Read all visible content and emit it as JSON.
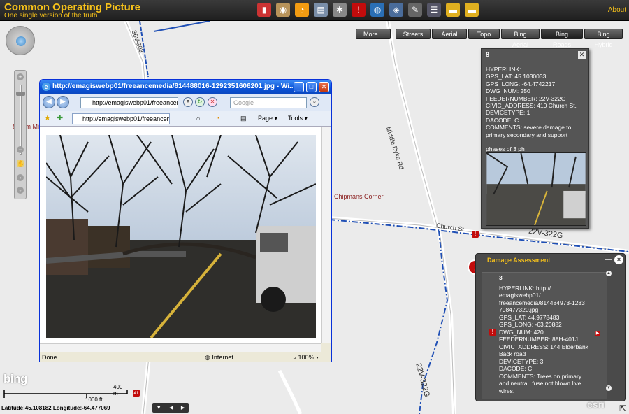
{
  "header": {
    "title": "Common Operating Picture",
    "subtitle": "One single version of the truth",
    "about_label": "About",
    "toolbar_icons": [
      "book-icon",
      "palette-icon",
      "rss-icon",
      "printer-icon",
      "settings-icon",
      "alert-icon",
      "globe-icon",
      "layers-icon",
      "tools-icon",
      "list-icon",
      "folder-icon",
      "folder-open-icon"
    ]
  },
  "basemaps": {
    "more_label": "More...",
    "options": [
      "Streets",
      "Aerial",
      "Topo",
      "Bing Aerial",
      "Bing Roads",
      "Bing Hybrid"
    ],
    "selected": "Bing Roads"
  },
  "map": {
    "labels": {
      "steam_mill": "Steam Mill",
      "chipmans_corner": "Chipmans Corner",
      "middle_dyke": "Middle Dyke Rd",
      "road_36v": "36V-303",
      "church_st": "Church St",
      "feeder_top": "22V-322G",
      "feeder_bottom": "22V-322G",
      "marker_41": "41"
    },
    "colors": {
      "feeder_line": "#1f4fb5",
      "alert_red": "#c20c0c",
      "accent_yellow": "#f7c21a"
    }
  },
  "popup8": {
    "id": "8",
    "lines": [
      "HYPERLINK:",
      "GPS_LAT: 45.1030033",
      "GPS_LONG: -64.4742217",
      "DWG_NUM: 250",
      "FEEDERNUMBER: 22V-322G",
      "CIVIC_ADDRESS: 410 Church St.",
      "DEVICETYPE: 1",
      "DACODE: C",
      "COMMENTS: severe damage to",
      "primary secondary and support",
      "",
      "phases of 3 ph"
    ]
  },
  "damage": {
    "title": "Damage Assessment",
    "minimize": "—",
    "close": "×",
    "id": "3",
    "lines": [
      "HYPERLINK: http://",
      "emagiswebp01/",
      "freeancemedia/814484973-1283",
      "708477320.jpg",
      "GPS_LAT: 44.9778483",
      "GPS_LONG: -63.20882",
      "DWG_NUM: 420",
      "FEEDERNUMBER: 88H-401J",
      "CIVIC_ADDRESS: 144 Elderbank",
      "Back road",
      "DEVICETYPE: 3",
      "DACODE: C",
      "COMMENTS: Trees on primary",
      "and neutral.  fuse not blown live",
      "wires."
    ]
  },
  "ie": {
    "title": "http://emagiswebp01/freeancemedia/814488016-1292351606201.jpg - Wi...",
    "address": "http://emagiswebp01/freeancer",
    "search_placeholder": "Google",
    "tab_label": "http://emagiswebp01/freeancem...",
    "page_label": "Page",
    "tools_label": "Tools",
    "status_done": "Done",
    "status_zone": "Internet",
    "status_zoom": "100%"
  },
  "scale": {
    "top_label": "400 m",
    "bottom_label": "1000 ft"
  },
  "coords": {
    "text": "Latitude:45.108182  Longitude:-64.477069"
  },
  "logos": {
    "bing": "bing",
    "esri": "esri"
  }
}
